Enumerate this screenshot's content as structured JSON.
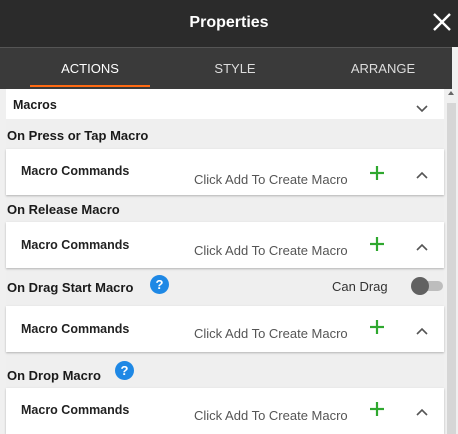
{
  "title": "Properties",
  "tabs": [
    {
      "label": "ACTIONS",
      "active": true
    },
    {
      "label": "STYLE",
      "active": false
    },
    {
      "label": "ARRANGE",
      "active": false
    }
  ],
  "macros": {
    "label": "Macros"
  },
  "sections": [
    {
      "label": "On Press or Tap Macro",
      "help": false,
      "commands_label": "Macro Commands",
      "hint": "Click Add To Create Macro"
    },
    {
      "label": "On Release Macro",
      "help": false,
      "commands_label": "Macro Commands",
      "hint": "Click Add To Create Macro"
    },
    {
      "label": "On Drag Start Macro",
      "help": true,
      "commands_label": "Macro Commands",
      "hint": "Click Add To Create Macro",
      "can_drag_label": "Can Drag",
      "can_drag": false
    },
    {
      "label": "On Drop Macro",
      "help": true,
      "commands_label": "Macro Commands",
      "hint": "Click Add To Create Macro"
    }
  ],
  "colors": {
    "accent_orange": "#ff6a13",
    "plus_green": "#2fa82f",
    "help_blue": "#1e88e5",
    "header_dark": "#2b2b2b"
  }
}
